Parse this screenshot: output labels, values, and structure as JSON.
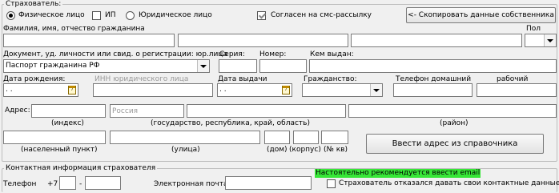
{
  "insured": {
    "title": "Страхователь:",
    "radio_physical": "Физическое лицо",
    "check_ip": "ИП",
    "radio_legal": "Юридическое лицо",
    "sms_consent": "Согласен на смс-рассылку",
    "copy_owner_button": "<- Скопировать данные собственника",
    "fio_label": "Фамилия, имя, отчество гражданина",
    "fio_values": [
      "",
      "",
      ""
    ],
    "gender_label": "Пол",
    "gender_value": "",
    "doc_label": "Документ, уд. личности или свид. о регистрации: юр.лица",
    "doc_value": "Паспорт гражданина РФ",
    "series_label": "Серия:",
    "number_label": "Номер:",
    "issued_by_label": "Кем выдан:",
    "birth_label": "Дата рождения:",
    "birth_value": ". .",
    "inn_label": "ИНН юридического лица",
    "issue_date_label": "Дата выдачи",
    "issue_date_value": ". .",
    "citizenship_label": "Гражданство:",
    "citizenship_value": "",
    "home_phone_label": "Телефон домашний",
    "work_phone_label": "рабочий",
    "calendar_glyph": "7",
    "address_label": "Адрес:",
    "country_placeholder": "Россия",
    "index_label": "(индекс)",
    "region_label": "(государство, республика, край, область)",
    "district_label": "(район)",
    "locality_label": "(населенный пункт)",
    "street_label": "(улица)",
    "house_label": "(дом)",
    "building_label": "(корпус)",
    "apt_label": "(№ кв)",
    "address_book_button": "Ввести адрес из справочника"
  },
  "contact": {
    "title": "Контактная информация страхователя",
    "phone_label": "Телефон",
    "phone_prefix": "+7",
    "phone_dash": "-",
    "email_label": "Электронная почта",
    "email_notice": "Настоятельно рекомендуется  ввести email",
    "refused_label": "Страхователь отказался давать свои контактные данные"
  }
}
